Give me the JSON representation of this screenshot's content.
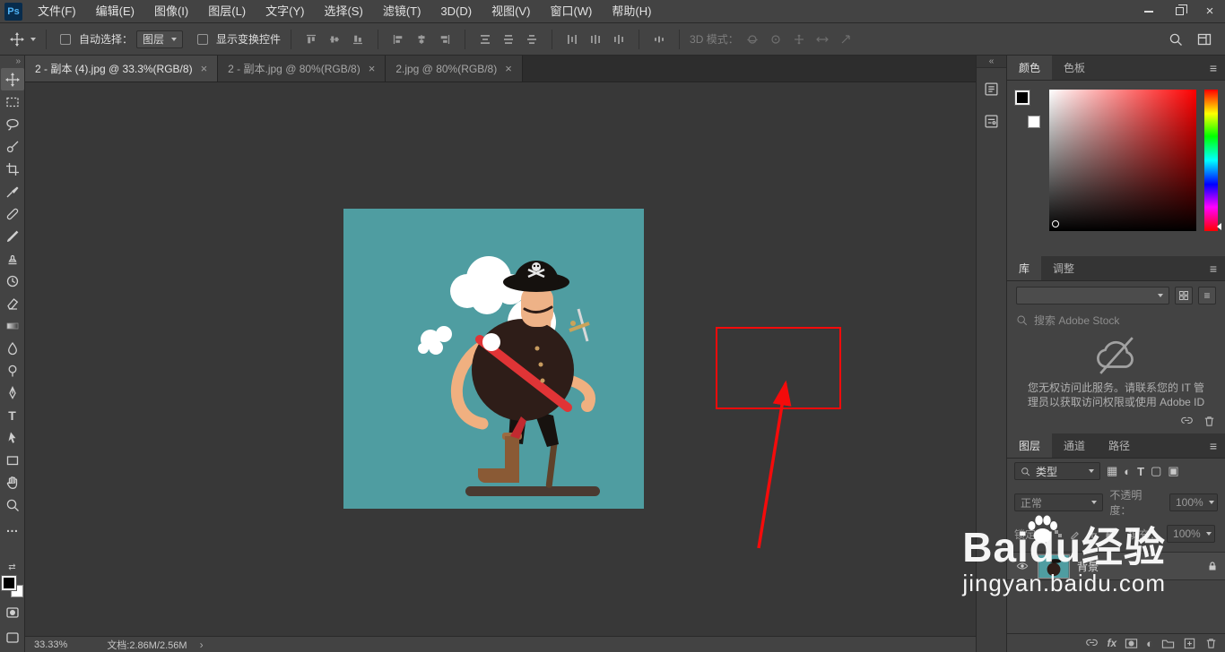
{
  "app": {
    "logo_text": "Ps"
  },
  "menubar": {
    "items": [
      "文件(F)",
      "编辑(E)",
      "图像(I)",
      "图层(L)",
      "文字(Y)",
      "选择(S)",
      "滤镜(T)",
      "3D(D)",
      "视图(V)",
      "窗口(W)",
      "帮助(H)"
    ]
  },
  "optionsbar": {
    "auto_select_label": "自动选择：",
    "auto_select_value": "图层",
    "show_transform_label": "显示变换控件",
    "mode_3d_label": "3D 模式："
  },
  "tabs": [
    {
      "title": "2 - 副本 (4).jpg @ 33.3%(RGB/8)"
    },
    {
      "title": "2 - 副本.jpg @ 80%(RGB/8)"
    },
    {
      "title": "2.jpg @ 80%(RGB/8)"
    }
  ],
  "panels": {
    "color": {
      "tab_color": "颜色",
      "tab_swatches": "色板"
    },
    "library": {
      "tab_library": "库",
      "tab_adjust": "调整",
      "search_placeholder": "搜索 Adobe Stock",
      "notice_line1": "您无权访问此服务。请联系您的 IT 管",
      "notice_line2": "理员以获取访问权限或使用 Adobe ID"
    },
    "layers": {
      "tab_layers": "图层",
      "tab_channels": "通道",
      "tab_paths": "路径",
      "filter_label": "类型",
      "blend_mode": "正常",
      "opacity_label": "不透明度：",
      "opacity_value": "100%",
      "lock_label": "锁定：",
      "fill_label": "填充：",
      "fill_value": "100%",
      "layer_name": "背景"
    }
  },
  "statusbar": {
    "zoom": "33.33%",
    "doc_info": "文档:2.86M/2.56M"
  },
  "watermark": {
    "brand": "Baidu",
    "brand_suffix": "经验",
    "url": "jingyan.baidu.com"
  },
  "icons": {
    "close": "×",
    "menu": "≡",
    "collapse": "«",
    "expand": "»",
    "ellipsis": "…",
    "type_tool": "T",
    "swap": "⇄",
    "fx": "fx",
    "filter_pixel": "▦",
    "filter_adjust": "◐",
    "filter_type": "T",
    "filter_shape": "▢",
    "filter_smart": "▣",
    "adjustment": "◐",
    "list_view": "≡",
    "chevron_right": "›"
  },
  "colors": {
    "accent_red": "#f40b0b",
    "canvas_teal": "#4f9da1"
  }
}
